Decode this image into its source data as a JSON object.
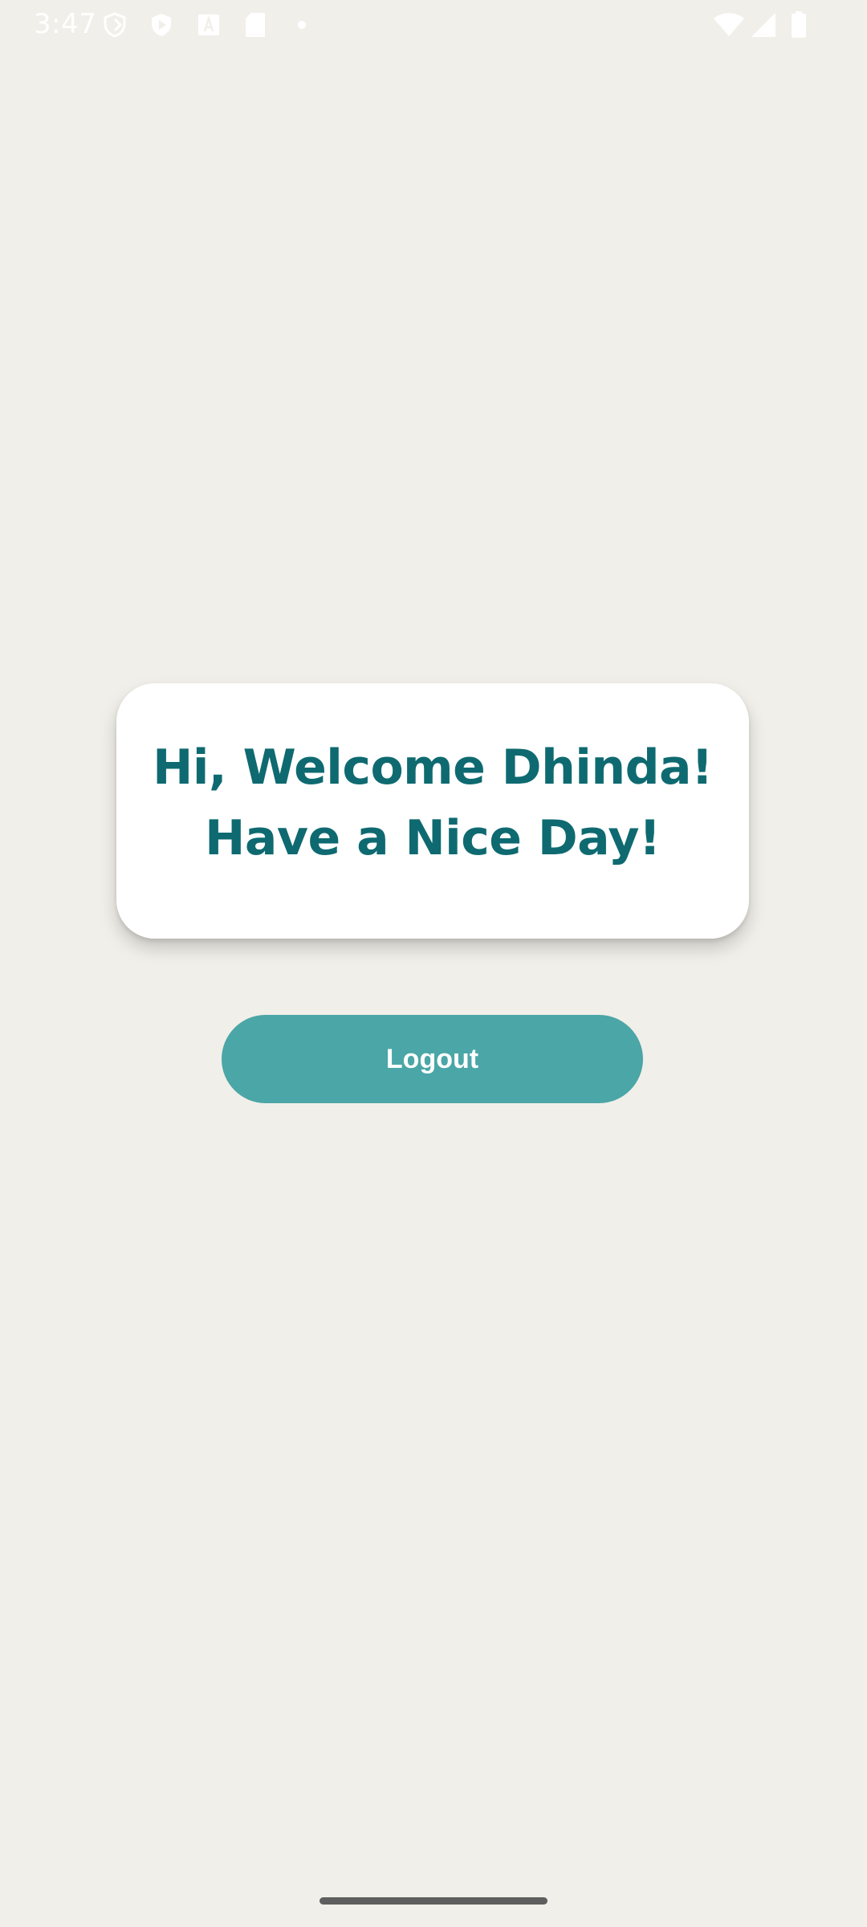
{
  "status_bar": {
    "time": "3:47",
    "left_icons": [
      "shield-outline-icon",
      "play-shield-icon",
      "a-badge-icon",
      "sd-card-icon",
      "dot-icon"
    ],
    "right_icons": [
      "wifi-icon",
      "signal-icon",
      "battery-icon"
    ]
  },
  "card": {
    "line1": "Hi, Welcome Dhinda!",
    "line2": "Have a Nice Day!"
  },
  "logout_button": {
    "label": "Logout"
  },
  "colors": {
    "background": "#f1efe9",
    "card": "#ffffff",
    "heading": "#0e6a70",
    "button": "#4ba6a7",
    "button_text": "#ffffff"
  }
}
